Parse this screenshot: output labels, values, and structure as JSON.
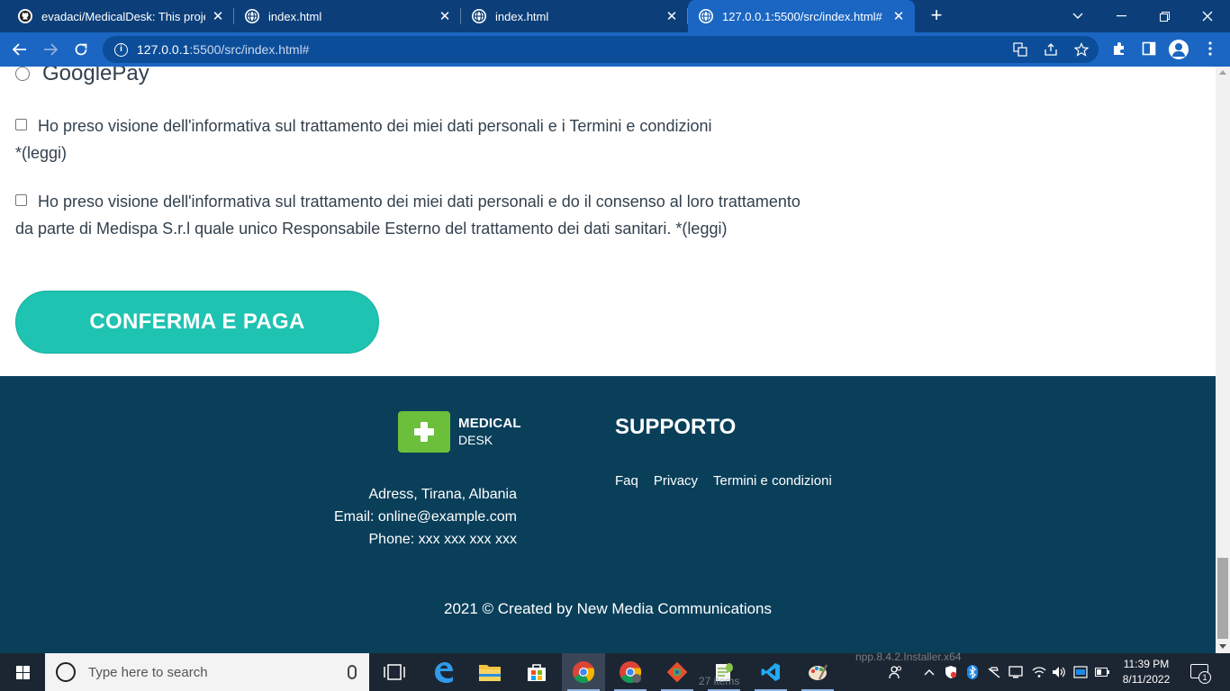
{
  "browser": {
    "tabs": [
      {
        "title": "evadaci/MedicalDesk: This project",
        "active": false,
        "close": "✕"
      },
      {
        "title": "index.html",
        "active": false,
        "close": "✕"
      },
      {
        "title": "index.html",
        "active": false,
        "close": "✕"
      },
      {
        "title": "127.0.0.1:5500/src/index.html#",
        "active": true,
        "close": "✕"
      }
    ],
    "new_tab": "+",
    "url_host": "127.0.0.1",
    "url_path": ":5500/src/index.html#"
  },
  "checkout": {
    "payment_option": "GooglePay",
    "consent_terms": "Ho preso visione dell'informativa sul trattamento dei miei dati personali e i Termini e condizioni *(leggi)",
    "consent_health": "Ho preso visione dell'informativa sul trattamento dei miei dati personali e do il consenso al loro trattamento da parte di Medispa S.r.l quale unico Responsabile Esterno del trattamento dei dati sanitari. *(leggi)",
    "confirm_button": "CONFERMA E PAGA"
  },
  "footer": {
    "logo_line1": "MEDICAL",
    "logo_line2": "DESK",
    "address": "Adress, Tirana, Albania",
    "email": "Email: online@example.com",
    "phone": "Phone: xxx xxx xxx xxx",
    "support_title": "SUPPORTO",
    "links": [
      "Faq",
      "Privacy",
      "Termini e condizioni"
    ],
    "copyright": "2021 © Created by New Media Communications"
  },
  "taskbar": {
    "search_placeholder": "Type here to search",
    "time": "11:39 PM",
    "date": "8/11/2022",
    "notification_count": "1",
    "ghost_installer": "npp.8.4.2.Installer.x64",
    "ghost_items": "27 items"
  },
  "colors": {
    "chrome_dark": "#0c3f7a",
    "chrome_toolbar": "#1a66c2",
    "accent_teal": "#1fc3b1",
    "footer_bg": "#0a3f5a",
    "logo_green": "#6cbf3a"
  }
}
